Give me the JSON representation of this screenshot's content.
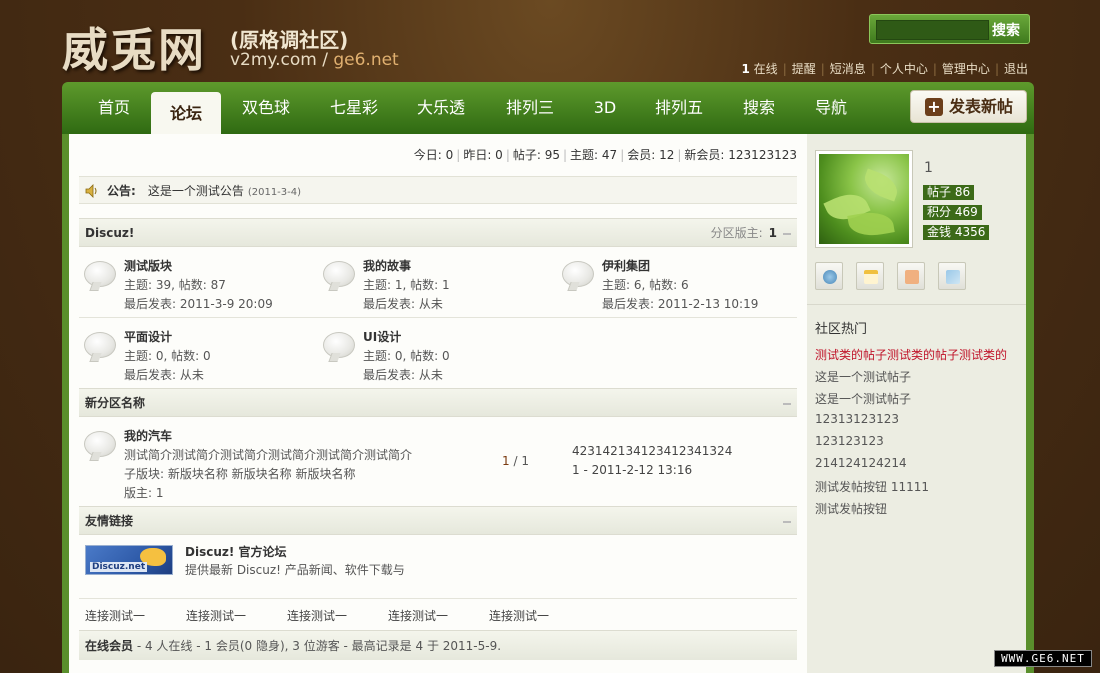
{
  "header": {
    "logo_main": "威兎网",
    "logo_sub": "(原格调社区)",
    "logo_url": "v2my.com",
    "logo_url_sep": " / ",
    "logo_url_alt": "ge6.net",
    "search_button": "搜索",
    "search_value": "",
    "userbar": {
      "online_count": "1",
      "online_label": "在线",
      "items": [
        "提醒",
        "短消息",
        "个人中心",
        "管理中心",
        "退出"
      ]
    }
  },
  "nav": {
    "items": [
      "首页",
      "论坛",
      "双色球",
      "七星彩",
      "大乐透",
      "排列三",
      "3D",
      "排列五",
      "搜索",
      "导航"
    ],
    "active_index": 1,
    "post_button": "发表新帖"
  },
  "stats": {
    "today": "今日: 0",
    "yesterday": "昨日: 0",
    "posts": "帖子: 95",
    "topics": "主题: 47",
    "members": "会员: 12",
    "newest": "新会员: 123123123"
  },
  "notice": {
    "label": "公告:",
    "text": "这是一个测试公告",
    "date": "(2011-3-4)"
  },
  "category1": {
    "title": "Discuz!",
    "moderator_label": "分区版主:",
    "moderator": "1",
    "forums": [
      {
        "name": "测试版块",
        "stats": "主题: 39, 帖数: 87",
        "last": "最后发表: 2011-3-9 20:09"
      },
      {
        "name": "我的故事",
        "stats": "主题: 1, 帖数: 1",
        "last": "最后发表: 从未"
      },
      {
        "name": "伊利集团",
        "stats": "主题: 6, 帖数: 6",
        "last": "最后发表: 2011-2-13 10:19"
      },
      {
        "name": "平面设计",
        "stats": "主题: 0, 帖数: 0",
        "last": "最后发表: 从未"
      },
      {
        "name": "UI设计",
        "stats": "主题: 0, 帖数: 0",
        "last": "最后发表: 从未"
      }
    ]
  },
  "category2": {
    "title": "新分区名称",
    "forum": {
      "name": "我的汽车",
      "desc": "测试简介测试简介测试简介测试简介测试简介测试简介",
      "subforums": "子版块: 新版块名称  新版块名称  新版块名称",
      "moderator": "版主: 1",
      "count_a": "1",
      "count_sep": " / ",
      "count_b": "1",
      "last_title": "423142134123412341324",
      "last_time": "1 - 2011-2-12 13:16"
    }
  },
  "links": {
    "title": "友情链接",
    "logo_text": "Discuz.net",
    "site_name": "Discuz! 官方论坛",
    "site_desc": "提供最新 Discuz! 产品新闻、软件下载与",
    "text_links": [
      "连接测试一",
      "连接测试一",
      "连接测试一",
      "连接测试一",
      "连接测试一"
    ]
  },
  "online": {
    "label": "在线会员",
    "text": " - 4 人在线 - 1 会员(0 隐身), 3 位游客 - 最高记录是 4 于 2011-5-9."
  },
  "sidebar": {
    "username": "1",
    "badges": [
      "帖子 86",
      "积分 469",
      "金钱 4356"
    ],
    "hot_title": "社区热门",
    "hot_items": [
      {
        "text": "测试类的帖子测试类的帖子测试类的",
        "red": true
      },
      {
        "text": "这是一个测试帖子",
        "red": false
      },
      {
        "text": "这是一个测试帖子",
        "red": false
      },
      {
        "text": "12313123123",
        "red": false
      },
      {
        "text": "123123123",
        "red": false
      },
      {
        "text": "214124124214",
        "red": false
      },
      {
        "text": "测试发帖按钮 11111",
        "red": false
      },
      {
        "text": "测试发帖按钮",
        "red": false
      }
    ]
  },
  "watermark": "WWW.GE6.NET",
  "colors": {
    "nav_green": "#4a8420",
    "bg_brown": "#4a2e14",
    "hot_red": "#c0142a"
  }
}
